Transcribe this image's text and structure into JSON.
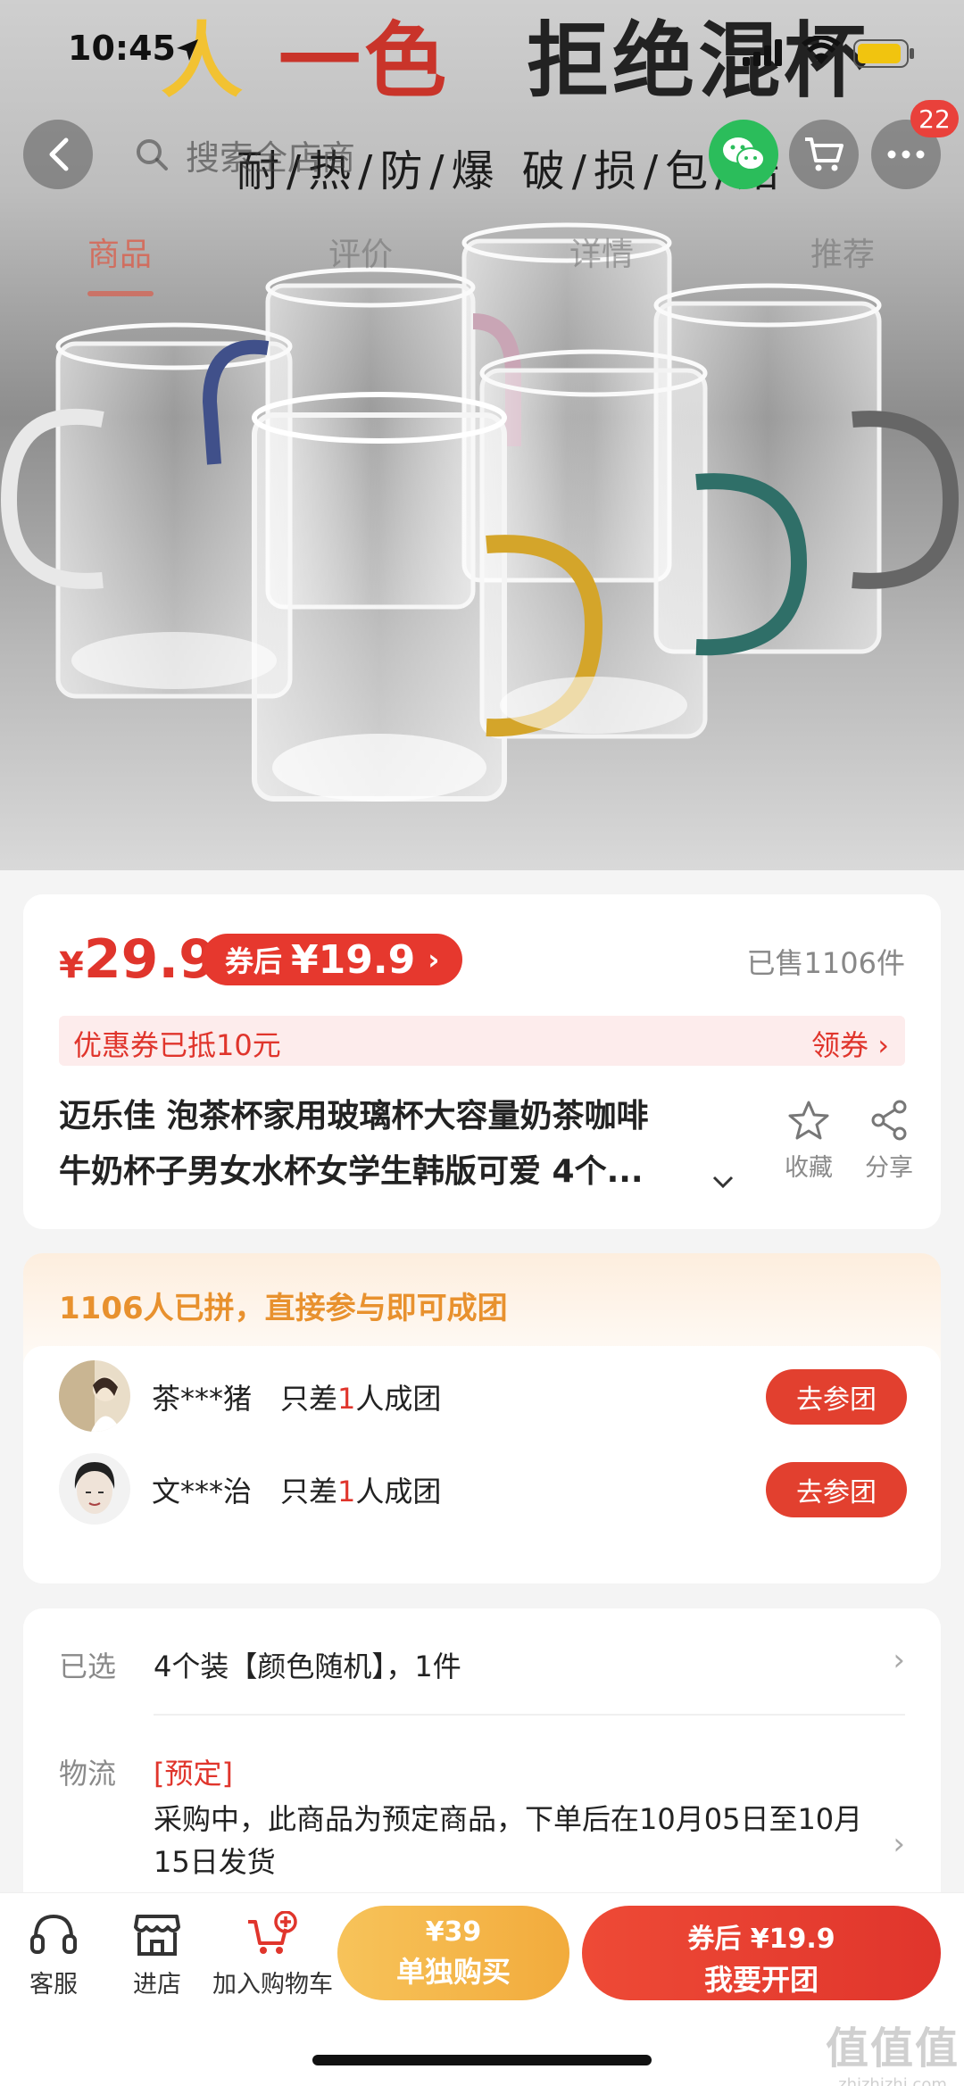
{
  "status_bar": {
    "time": "10:45"
  },
  "hero": {
    "headline_part1": "人",
    "headline_part2": "一色",
    "headline_part3": "拒绝混杯",
    "subline": "耐/热/防/爆   破/损/包/赔"
  },
  "nav": {
    "search_placeholder": "搜索全店商",
    "cart_badge": "22",
    "icons": [
      "back-icon",
      "search-icon",
      "wechat-icon",
      "cart-icon",
      "more-icon"
    ]
  },
  "tabs": [
    {
      "label": "商品",
      "active": true
    },
    {
      "label": "评价",
      "active": false
    },
    {
      "label": "详情",
      "active": false
    },
    {
      "label": "推荐",
      "active": false
    }
  ],
  "product": {
    "currency": "¥",
    "price": "29.9",
    "coupon_label": "券后",
    "coupon_price": "¥19.9",
    "sold": "已售1106件",
    "coupon_note": "优惠券已抵10元",
    "coupon_action": "领券",
    "title_line1": "迈乐佳  泡茶杯家用玻璃杯大容量奶茶咖啡",
    "title_line2": "牛奶杯子男女水杯女学生韩版可爱 4个...",
    "fav_label": "收藏",
    "share_label": "分享"
  },
  "group_buy": {
    "header": "1106人已拼，直接参与即可成团",
    "rows": [
      {
        "name": "茶***猪",
        "desc_pre": "只差",
        "count": "1",
        "desc_post": "人成团",
        "button": "去参团"
      },
      {
        "name": "文***治",
        "desc_pre": "只差",
        "count": "1",
        "desc_post": "人成团",
        "button": "去参团"
      }
    ]
  },
  "spec": {
    "selected_label": "已选",
    "selected_value": "4个装【颜色随机】，1件",
    "logistics_label": "物流",
    "logistics_tag": "[预定]",
    "logistics_text": " 采购中，此商品为预定商品，下单后在10月05日至10月15日发货"
  },
  "bottom_bar": {
    "service": "客服",
    "store": "进店",
    "add_cart": "加入购物车",
    "solo_price": "¥39",
    "solo_label": "单独购买",
    "group_price": "券后 ¥19.9",
    "group_label": "我要开团"
  },
  "watermark": {
    "line1": "值值值",
    "line2": "zhizhizhi.com"
  },
  "colors": {
    "accent_red": "#e0352c",
    "orange": "#f2ab3c",
    "wechat_green": "#2bbd5b",
    "group_header": "#e8912e"
  }
}
